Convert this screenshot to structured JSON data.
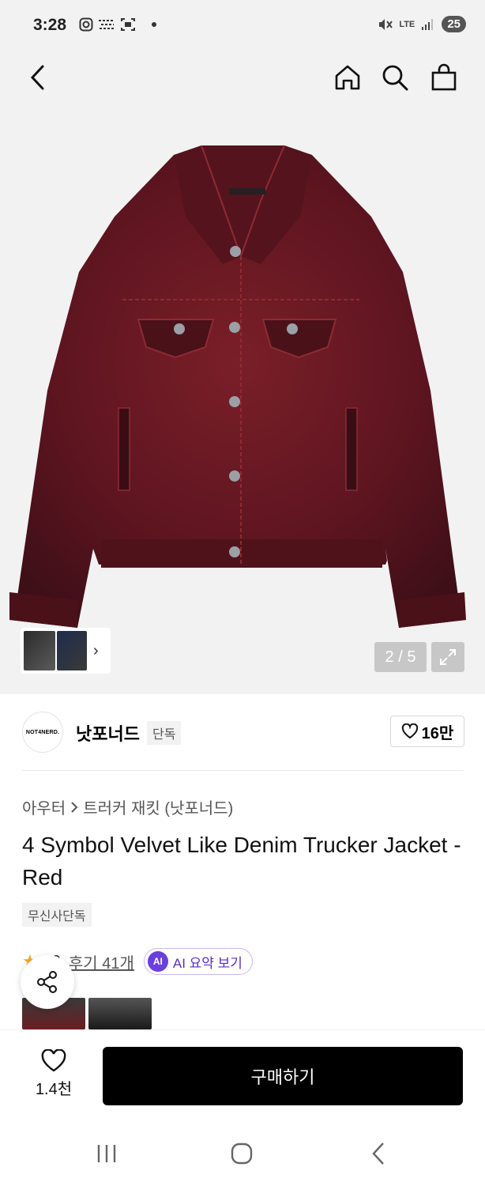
{
  "status_bar": {
    "time": "3:28",
    "network": "LTE",
    "battery": "25"
  },
  "nav": {
    "back_icon": "chevron-left-icon",
    "home_icon": "home-icon",
    "search_icon": "search-icon",
    "bag_icon": "shopping-bag-icon"
  },
  "gallery": {
    "counter": "2 / 5",
    "thumb_arrow": "›"
  },
  "brand": {
    "logo_text": "NOT4NERD.",
    "name": "낫포너드",
    "tag": "단독",
    "like_count": "16만"
  },
  "product": {
    "breadcrumb": [
      "아우터",
      "트러커 재킷 (낫포너드)"
    ],
    "title": "4 Symbol Velvet Like Denim Trucker Jacket - Red",
    "badge": "무신사단독",
    "rating_partial": "9",
    "review_link": "후기 41개",
    "ai_badge": "AI",
    "ai_button": "AI 요약 보기"
  },
  "buy_bar": {
    "wish_count": "1.4천",
    "buy_button": "구매하기"
  },
  "colors": {
    "jacket": "#6e1a22",
    "accent_purple": "#6b3fd9",
    "star": "#f5a623"
  }
}
